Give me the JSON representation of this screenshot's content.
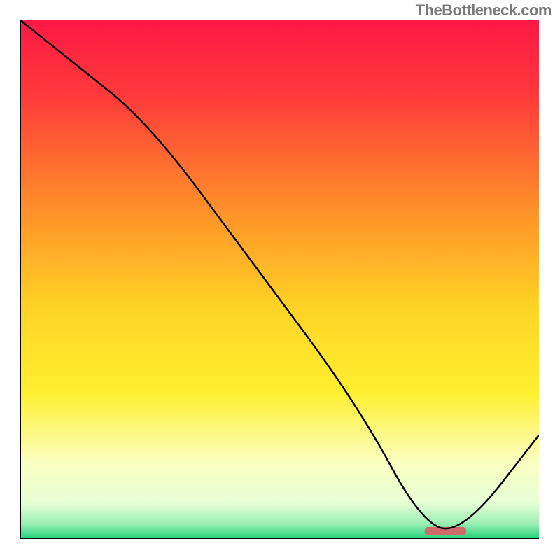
{
  "watermark": "TheBottleneck.com",
  "chart_data": {
    "type": "line",
    "title": "",
    "xlabel": "",
    "ylabel": "",
    "xlim": [
      0,
      100
    ],
    "ylim": [
      0,
      100
    ],
    "grid": false,
    "legend": false,
    "series": [
      {
        "name": "curve",
        "x": [
          0,
          10,
          25,
          45,
          65,
          78,
          86,
          100
        ],
        "y": [
          100,
          92,
          80,
          53,
          26,
          2,
          2,
          20
        ]
      }
    ],
    "marker_band": {
      "x0": 78,
      "x1": 86,
      "y": 1.5,
      "color": "#d06a6a"
    },
    "background_gradient": {
      "stops": [
        {
          "offset": 0.0,
          "color": "#ff1846"
        },
        {
          "offset": 0.15,
          "color": "#ff3b3b"
        },
        {
          "offset": 0.35,
          "color": "#ff8a2a"
        },
        {
          "offset": 0.55,
          "color": "#ffd225"
        },
        {
          "offset": 0.72,
          "color": "#fff031"
        },
        {
          "offset": 0.85,
          "color": "#fbffc0"
        },
        {
          "offset": 0.93,
          "color": "#e8ffd6"
        },
        {
          "offset": 0.97,
          "color": "#9df0b4"
        },
        {
          "offset": 1.0,
          "color": "#21d07a"
        }
      ]
    },
    "axis_color": "#000000",
    "line_color": "#000000",
    "line_width": 2.5
  }
}
